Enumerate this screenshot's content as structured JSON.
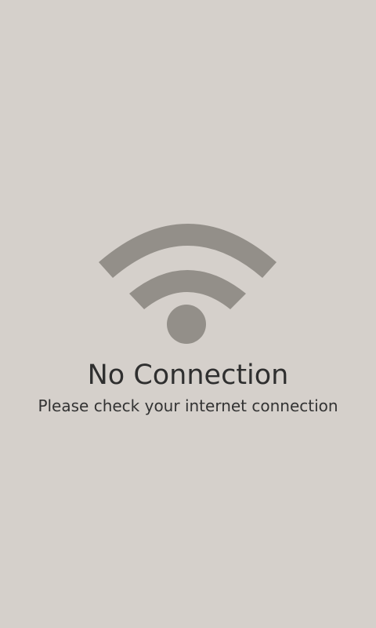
{
  "screen": {
    "background": "#d5d0cb",
    "icon": {
      "name": "wifi-icon",
      "color": "#938f89"
    },
    "title": "No Connection",
    "message": "Please check your internet connection"
  }
}
